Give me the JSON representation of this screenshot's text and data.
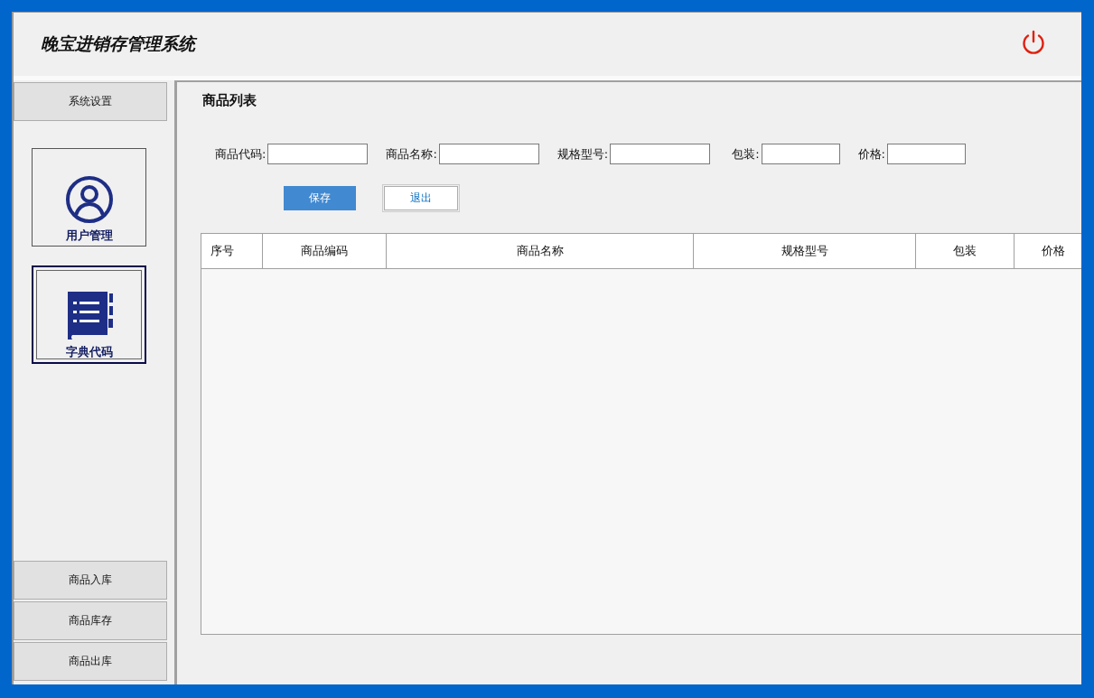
{
  "header": {
    "title": "晚宝进销存管理系统"
  },
  "sidebar": {
    "top_button": "系统设置",
    "tiles": [
      {
        "label": "用户管理",
        "kind": "user",
        "selected": false
      },
      {
        "label": "字典代码",
        "kind": "book",
        "selected": true
      }
    ],
    "bottom_buttons": [
      "商品入库",
      "商品库存",
      "商品出库"
    ]
  },
  "panel": {
    "title": "商品列表",
    "fields": [
      {
        "label": "商品代码:"
      },
      {
        "label": "商品名称:"
      },
      {
        "label": "规格型号:"
      },
      {
        "label": "包装:"
      },
      {
        "label": "价格:"
      }
    ],
    "buttons": [
      {
        "label": "保存",
        "kind": "primary"
      },
      {
        "label": "退出",
        "kind": "secondary"
      }
    ],
    "table": {
      "columns": [
        "序号",
        "商品编码",
        "商品名称",
        "规格型号",
        "包装",
        "价格"
      ]
    }
  }
}
